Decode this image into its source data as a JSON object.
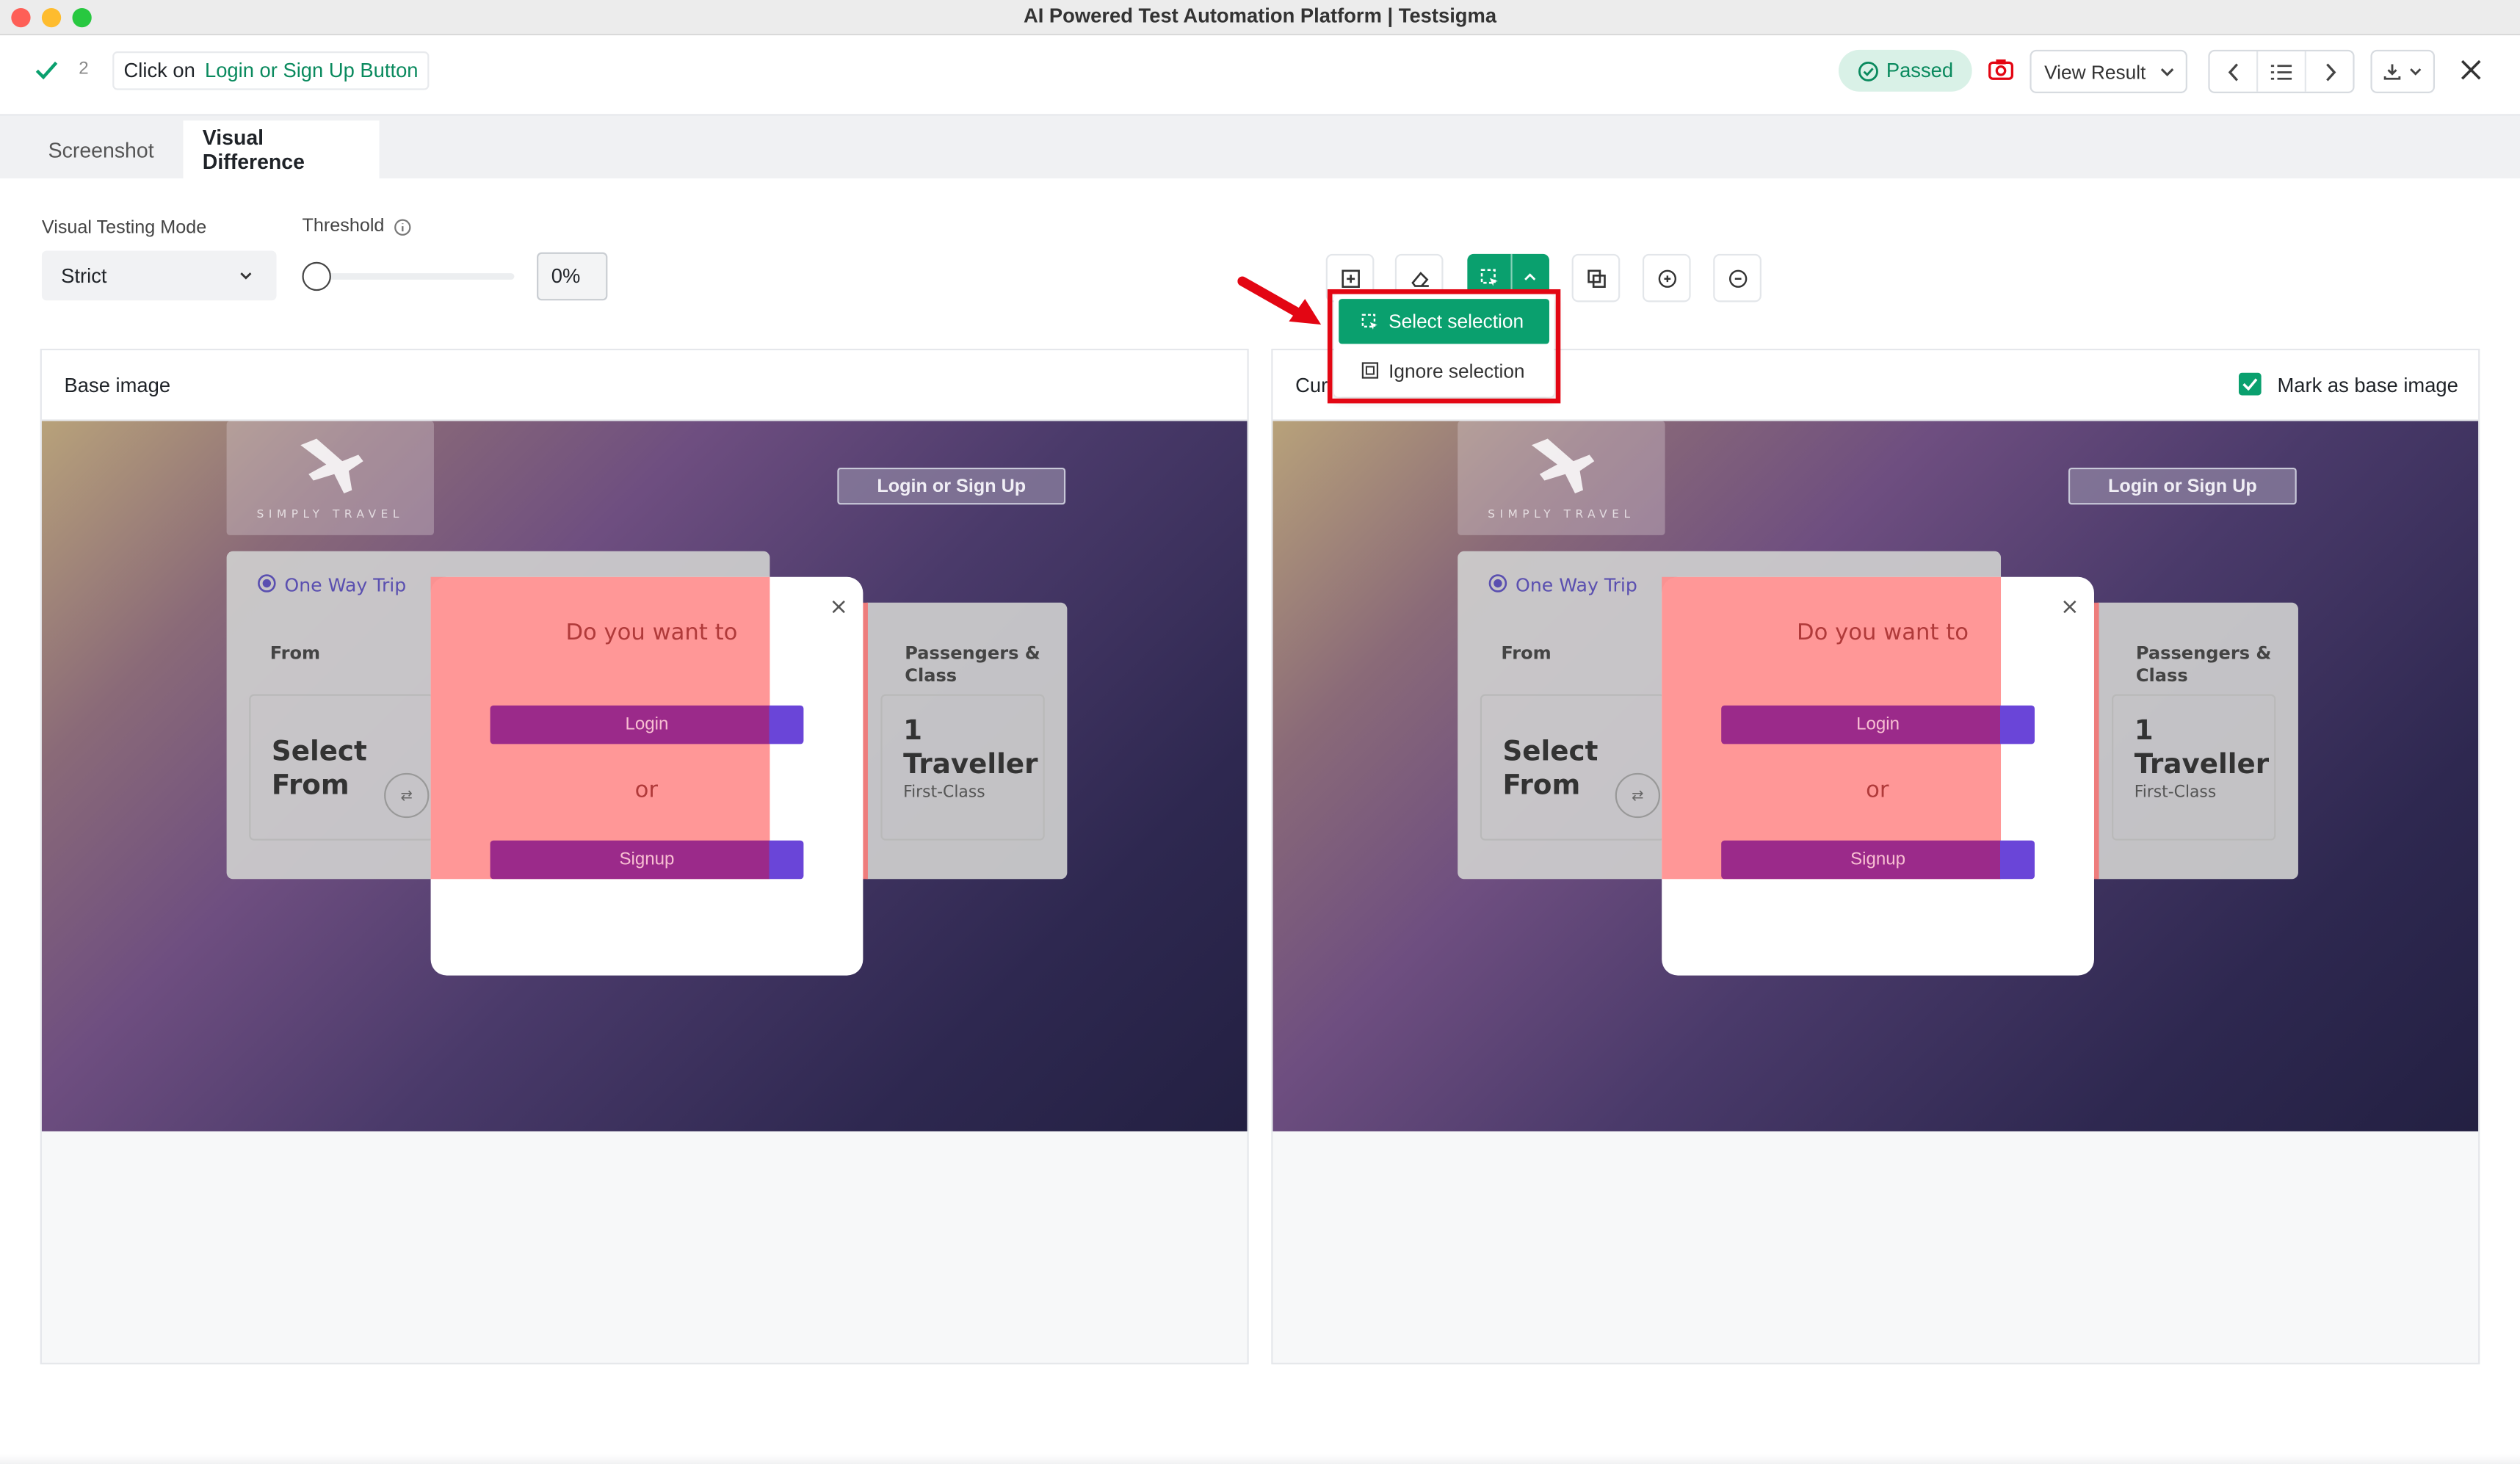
{
  "window": {
    "title": "AI Powered Test Automation Platform | Testsigma"
  },
  "step": {
    "number": "2",
    "action": "Click on",
    "target": "Login or Sign Up Button"
  },
  "header": {
    "status": "Passed",
    "view_result": "View Result"
  },
  "tabs": [
    {
      "label": "Screenshot"
    },
    {
      "label": "Visual Difference"
    }
  ],
  "controls": {
    "mode_label": "Visual Testing Mode",
    "mode_value": "Strict",
    "threshold_label": "Threshold",
    "threshold_value": "0%",
    "threshold_level": 0
  },
  "toolbar": {
    "dropdown": [
      {
        "label": "Select selection",
        "selected": true
      },
      {
        "label": "Ignore selection",
        "selected": false
      }
    ]
  },
  "panels": {
    "base": {
      "title": "Base image"
    },
    "current": {
      "title": "Cur",
      "mark_label": "Mark as base image",
      "mark_checked": true
    }
  },
  "screenshot": {
    "logo_text": "SIMPLY TRAVEL",
    "login_button": "Login or Sign Up",
    "trip_option": "One Way Trip",
    "from_label": "From",
    "select_from": [
      "Select",
      "From"
    ],
    "passengers_label": [
      "Passengers &",
      "Class"
    ],
    "traveller_count": "1",
    "traveller_label": "Traveller",
    "class_value": "First-Class",
    "modal_title": "Do you want to",
    "modal_login": "Login",
    "modal_or": "or",
    "modal_signup": "Signup",
    "close_glyph": "×",
    "swap_glyph": "⇄"
  },
  "colors": {
    "accent": "#0aa06e",
    "highlight": "#e30613",
    "diff": "#ff8c8c"
  }
}
